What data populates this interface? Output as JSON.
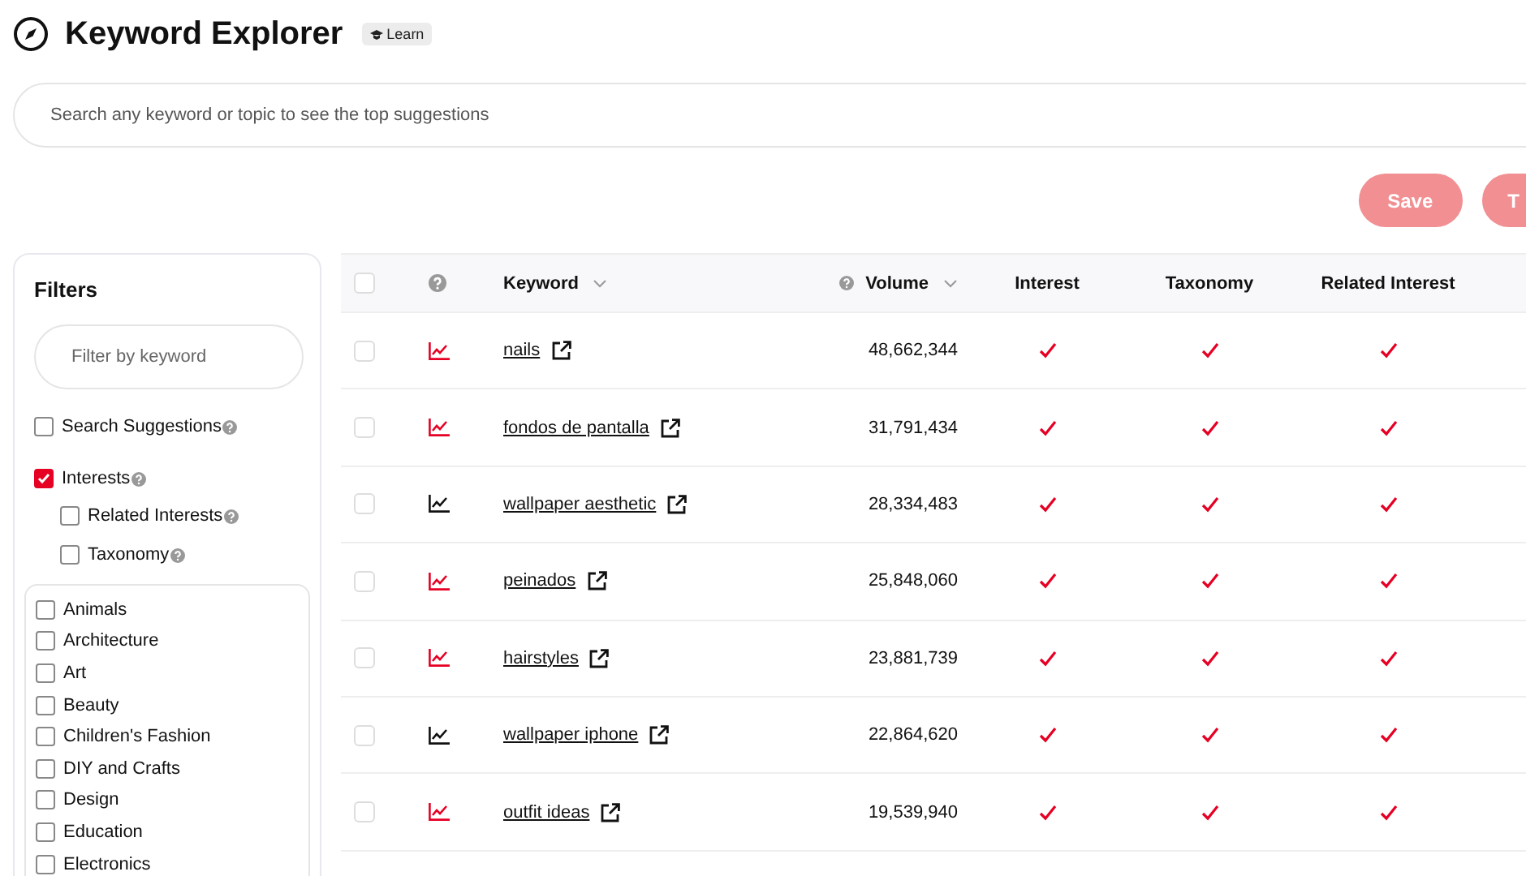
{
  "header": {
    "title": "Keyword Explorer",
    "learn": "Learn"
  },
  "search": {
    "placeholder": "Search any keyword or topic to see the top suggestions"
  },
  "actions": [
    "Save",
    "T"
  ],
  "filters": {
    "title": "Filters",
    "placeholder": "Filter by keyword",
    "options": [
      {
        "label": "Search Suggestions",
        "checked": false
      },
      {
        "label": "Interests",
        "checked": true,
        "children": [
          {
            "label": "Related Interests",
            "checked": false
          },
          {
            "label": "Taxonomy",
            "checked": false
          }
        ]
      }
    ],
    "categories": [
      {
        "label": "Animals",
        "checked": false
      },
      {
        "label": "Architecture",
        "checked": false
      },
      {
        "label": "Art",
        "checked": false
      },
      {
        "label": "Beauty",
        "checked": false
      },
      {
        "label": "Children's Fashion",
        "checked": false
      },
      {
        "label": "DIY and Crafts",
        "checked": false
      },
      {
        "label": "Design",
        "checked": false
      },
      {
        "label": "Education",
        "checked": false
      },
      {
        "label": "Electronics",
        "checked": false
      }
    ]
  },
  "table": {
    "all_selected": false,
    "columns": [
      "Keyword",
      "Volume",
      "Interest",
      "Taxonomy",
      "Related Interest"
    ],
    "rows": [
      {
        "selected": false,
        "color": "#e60023",
        "keyword": "nails",
        "volume": "48,662,344",
        "interest": true,
        "taxonomy": true,
        "related": true
      },
      {
        "selected": false,
        "color": "#e60023",
        "keyword": "fondos de pantalla",
        "volume": "31,791,434",
        "interest": true,
        "taxonomy": true,
        "related": true
      },
      {
        "selected": false,
        "color": "#111111",
        "keyword": "wallpaper aesthetic",
        "volume": "28,334,483",
        "interest": true,
        "taxonomy": true,
        "related": true
      },
      {
        "selected": false,
        "color": "#e60023",
        "keyword": "peinados",
        "volume": "25,848,060",
        "interest": true,
        "taxonomy": true,
        "related": true
      },
      {
        "selected": false,
        "color": "#e60023",
        "keyword": "hairstyles",
        "volume": "23,881,739",
        "interest": true,
        "taxonomy": true,
        "related": true
      },
      {
        "selected": false,
        "color": "#111111",
        "keyword": "wallpaper iphone",
        "volume": "22,864,620",
        "interest": true,
        "taxonomy": true,
        "related": true
      },
      {
        "selected": false,
        "color": "#e60023",
        "keyword": "outfit ideas",
        "volume": "19,539,940",
        "interest": true,
        "taxonomy": true,
        "related": true
      }
    ]
  }
}
